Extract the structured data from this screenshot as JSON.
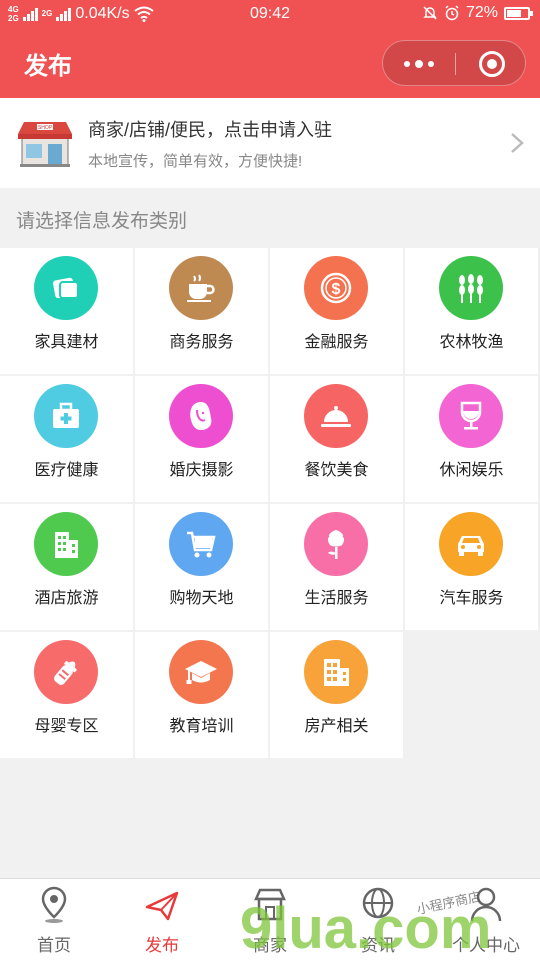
{
  "status_bar": {
    "network_top": "4G",
    "network_bottom": "2G",
    "network2_top": "2G",
    "speed": "0.04K/s",
    "time": "09:42",
    "battery": "72%",
    "battery_level": 0.72
  },
  "header": {
    "title": "发布",
    "more_icon": "more-dots-icon",
    "close_icon": "target-circle-icon"
  },
  "banner": {
    "title": "商家/店铺/便民，点击申请入驻",
    "subtitle": "本地宣传，简单有效，方便快捷!",
    "icon": "shop-storefront-icon",
    "shop_sign": "SHOP"
  },
  "section_label": "请选择信息发布类别",
  "categories": [
    {
      "label": "家具建材",
      "icon": "pillow-icon",
      "color": "#1fd0b6"
    },
    {
      "label": "商务服务",
      "icon": "coffee-cup-icon",
      "color": "#bf8a52"
    },
    {
      "label": "金融服务",
      "icon": "dollar-coin-icon",
      "color": "#f4724f"
    },
    {
      "label": "农林牧渔",
      "icon": "wheat-icon",
      "color": "#3cc24b"
    },
    {
      "label": "医疗健康",
      "icon": "medical-kit-icon",
      "color": "#4fcbe2"
    },
    {
      "label": "婚庆摄影",
      "icon": "bride-icon",
      "color": "#ee4fd1"
    },
    {
      "label": "餐饮美食",
      "icon": "food-cloche-icon",
      "color": "#f76464"
    },
    {
      "label": "休闲娱乐",
      "icon": "wine-glass-icon",
      "color": "#f265d2"
    },
    {
      "label": "酒店旅游",
      "icon": "hotel-building-icon",
      "color": "#4fca4f"
    },
    {
      "label": "购物天地",
      "icon": "shopping-cart-icon",
      "color": "#5fa7f0"
    },
    {
      "label": "生活服务",
      "icon": "flower-icon",
      "color": "#f76fa6"
    },
    {
      "label": "汽车服务",
      "icon": "car-icon",
      "color": "#f7a427"
    },
    {
      "label": "母婴专区",
      "icon": "baby-bottle-icon",
      "color": "#f76b6b"
    },
    {
      "label": "教育培训",
      "icon": "graduation-cap-icon",
      "color": "#f4764f"
    },
    {
      "label": "房产相关",
      "icon": "building-icon",
      "color": "#f7a33a"
    }
  ],
  "tabs": [
    {
      "label": "首页",
      "icon": "location-pin-icon"
    },
    {
      "label": "发布",
      "icon": "paper-plane-icon",
      "active": true
    },
    {
      "label": "商家",
      "icon": "store-icon"
    },
    {
      "label": "资讯",
      "icon": "globe-icon"
    },
    {
      "label": "个人中心",
      "icon": "person-icon"
    }
  ],
  "watermark": {
    "big": "9lua.com",
    "small": "小程序商店"
  },
  "colors": {
    "header_red": "#f05152",
    "active_tab": "#e83a3a"
  }
}
